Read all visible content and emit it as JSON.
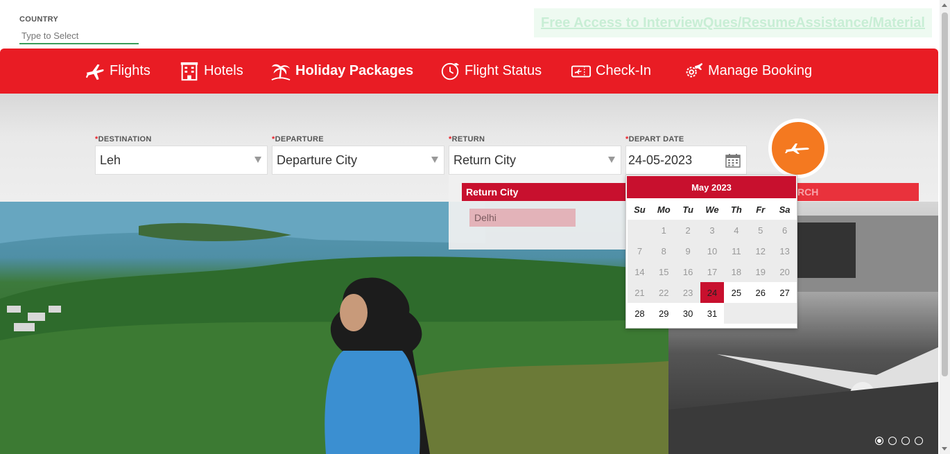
{
  "country": {
    "label": "COUNTRY",
    "placeholder": "Type to Select"
  },
  "promo_link": "Free Access to InterviewQues/ResumeAssistance/Material",
  "nav": {
    "items": [
      {
        "label": "Flights",
        "icon": "plane-icon"
      },
      {
        "label": "Hotels",
        "icon": "hotel-icon"
      },
      {
        "label": "Holiday Packages",
        "icon": "palm-tree-icon",
        "active": true
      },
      {
        "label": "Flight Status",
        "icon": "clock-plane-icon"
      },
      {
        "label": "Check-In",
        "icon": "ticket-icon"
      },
      {
        "label": "Manage Booking",
        "icon": "gear-plane-icon"
      }
    ]
  },
  "form": {
    "destination": {
      "label": "DESTINATION",
      "value": "Leh"
    },
    "departure": {
      "label": "DEPARTURE",
      "value": "Departure City"
    },
    "return": {
      "label": "RETURN",
      "value": "Return City"
    },
    "depart_date": {
      "label": "DEPART DATE",
      "value": "24-05-2023"
    },
    "required_mark": "*",
    "hidden_search_label": "RCH"
  },
  "return_dropdown": {
    "header": "Return City",
    "options": [
      "Delhi"
    ]
  },
  "calendar": {
    "title": "May 2023",
    "dow": [
      "Su",
      "Mo",
      "Tu",
      "We",
      "Th",
      "Fr",
      "Sa"
    ],
    "weeks": [
      [
        "",
        "1",
        "2",
        "3",
        "4",
        "5",
        "6"
      ],
      [
        "7",
        "8",
        "9",
        "10",
        "11",
        "12",
        "13"
      ],
      [
        "14",
        "15",
        "16",
        "17",
        "18",
        "19",
        "20"
      ],
      [
        "21",
        "22",
        "23",
        "24",
        "25",
        "26",
        "27"
      ],
      [
        "28",
        "29",
        "30",
        "31",
        "",
        "",
        ""
      ]
    ],
    "selected": "24"
  },
  "colors": {
    "brand_red": "#e91c24",
    "calendar_red": "#c8102e",
    "search_orange": "#f47920",
    "underline_green": "#3a9c5a"
  }
}
